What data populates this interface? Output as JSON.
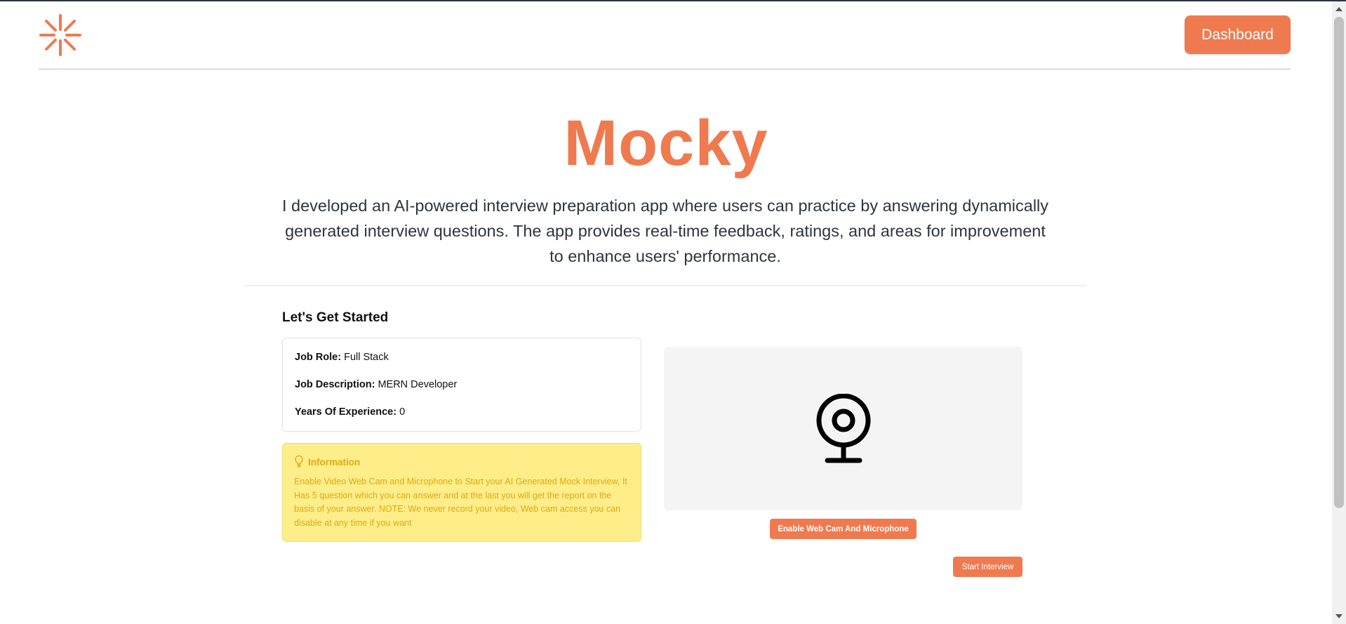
{
  "header": {
    "logo_icon": "asterisk-logo-icon",
    "dashboard_label": "Dashboard"
  },
  "hero": {
    "title": "Mocky",
    "description": "I developed an AI-powered interview preparation app where users can practice by answering dynamically generated interview questions. The app provides real-time feedback, ratings, and areas for improvement to enhance users' performance."
  },
  "interview": {
    "section_title": "Let's Get Started",
    "job_role_label": "Job Role:",
    "job_role_value": "Full Stack",
    "job_description_label": "Job Description:",
    "job_description_value": "MERN Developer",
    "experience_label": "Years Of Experience:",
    "experience_value": "0"
  },
  "notice": {
    "icon": "lightbulb-icon",
    "title": "Information",
    "body": "Enable Video Web Cam and Microphone to Start your AI Generated Mock Interview, It Has 5 question which you can answer and at the last you will get the report on the basis of your answer. NOTE: We never record your video, Web cam access you can disable at any time if you want"
  },
  "webcam": {
    "icon": "webcam-icon",
    "enable_label": "Enable Web Cam And Microphone",
    "start_label": "Start Interview"
  },
  "colors": {
    "accent": "#f07a4f",
    "notice_bg": "#fdee8a",
    "notice_text": "#e0a80c",
    "text_dark": "#2e3440"
  }
}
